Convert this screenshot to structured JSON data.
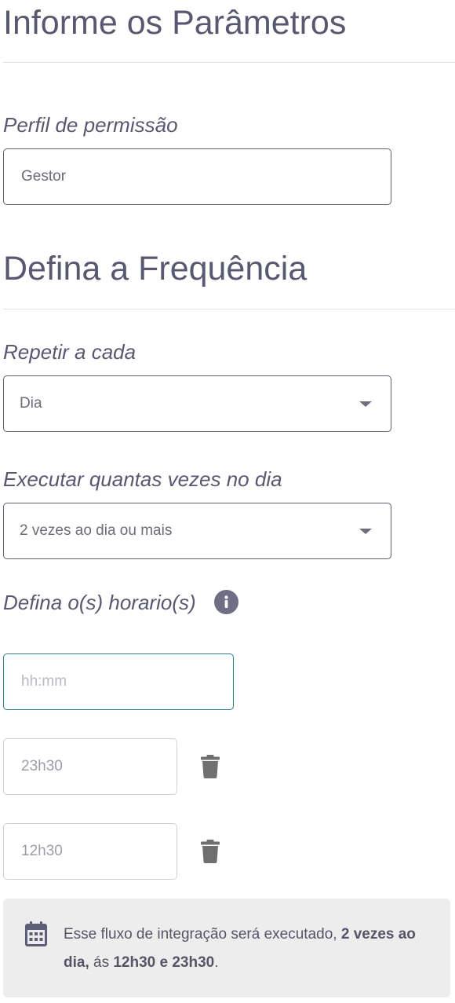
{
  "parameters": {
    "title": "Informe os Parâmetros",
    "permission_profile_label": "Perfil de permissão",
    "permission_profile_value": "Gestor"
  },
  "frequency": {
    "title": "Defina a Frequência",
    "repeat_label": "Repetir a cada",
    "repeat_value": "Dia",
    "times_per_day_label": "Executar quantas vezes no dia",
    "times_per_day_value": "2 vezes ao dia ou mais",
    "schedule_label": "Defina o(s) horario(s)",
    "time_input_placeholder": "hh:mm",
    "times": [
      "23h30",
      "12h30"
    ]
  },
  "summary": {
    "prefix": "Esse fluxo de integração será executado, ",
    "frequency_bold": "2 vezes ao dia,",
    "middle": " ás ",
    "times_bold": "12h30 e 23h30",
    "suffix": "."
  },
  "icons": {
    "info": "info-icon",
    "trash": "trash-icon",
    "calendar": "calendar-icon",
    "caret": "caret-down-icon"
  },
  "colors": {
    "heading": "#585870",
    "focus_border": "#2a7d8c",
    "icon_gray": "#6e6e84",
    "summary_bg": "#ededee"
  }
}
